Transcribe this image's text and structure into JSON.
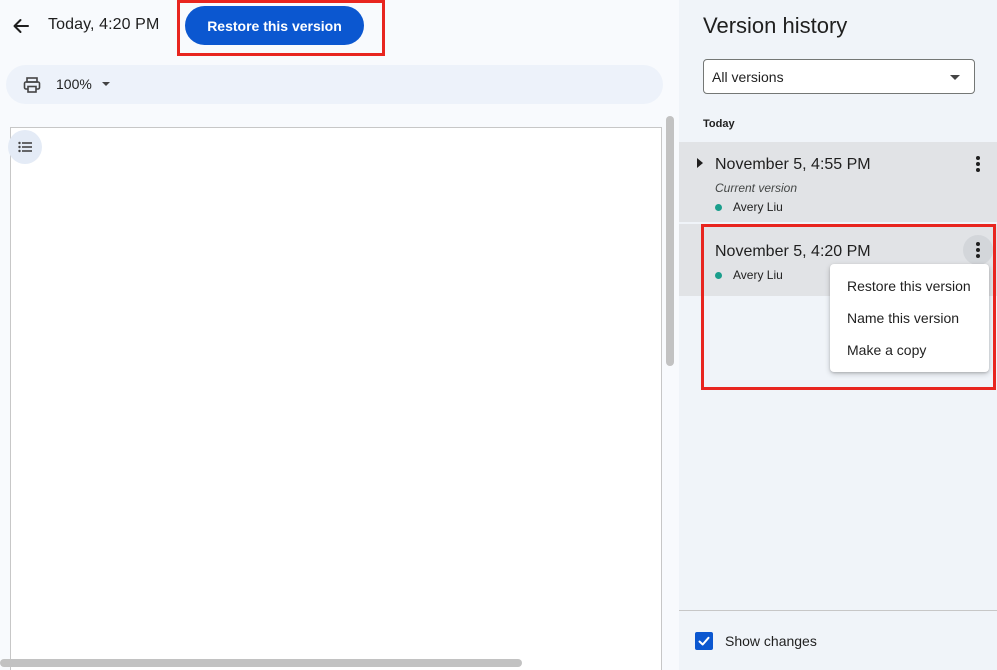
{
  "header": {
    "title": "Today, 4:20 PM",
    "restore_button": "Restore this version"
  },
  "toolbar": {
    "zoom": "100%"
  },
  "icons": {
    "back": "arrow-back-icon",
    "print": "printer-icon",
    "outline": "list-outline-icon",
    "menu": "more-vert-icon",
    "expand": "triangle-right-icon",
    "check": "check-icon"
  },
  "panel": {
    "title": "Version history",
    "filter": "All versions",
    "section": "Today",
    "versions": [
      {
        "time": "November 5, 4:55 PM",
        "subtitle": "Current version",
        "author": "Avery Liu"
      },
      {
        "time": "November 5, 4:20 PM",
        "author": "Avery Liu"
      }
    ],
    "menu": [
      "Restore this version",
      "Name this version",
      "Make a copy"
    ],
    "show_changes": "Show changes",
    "show_changes_checked": true
  },
  "colors": {
    "accent": "#0b57d0",
    "highlight": "#e8251f",
    "author_dot": "#1a9e8c"
  }
}
